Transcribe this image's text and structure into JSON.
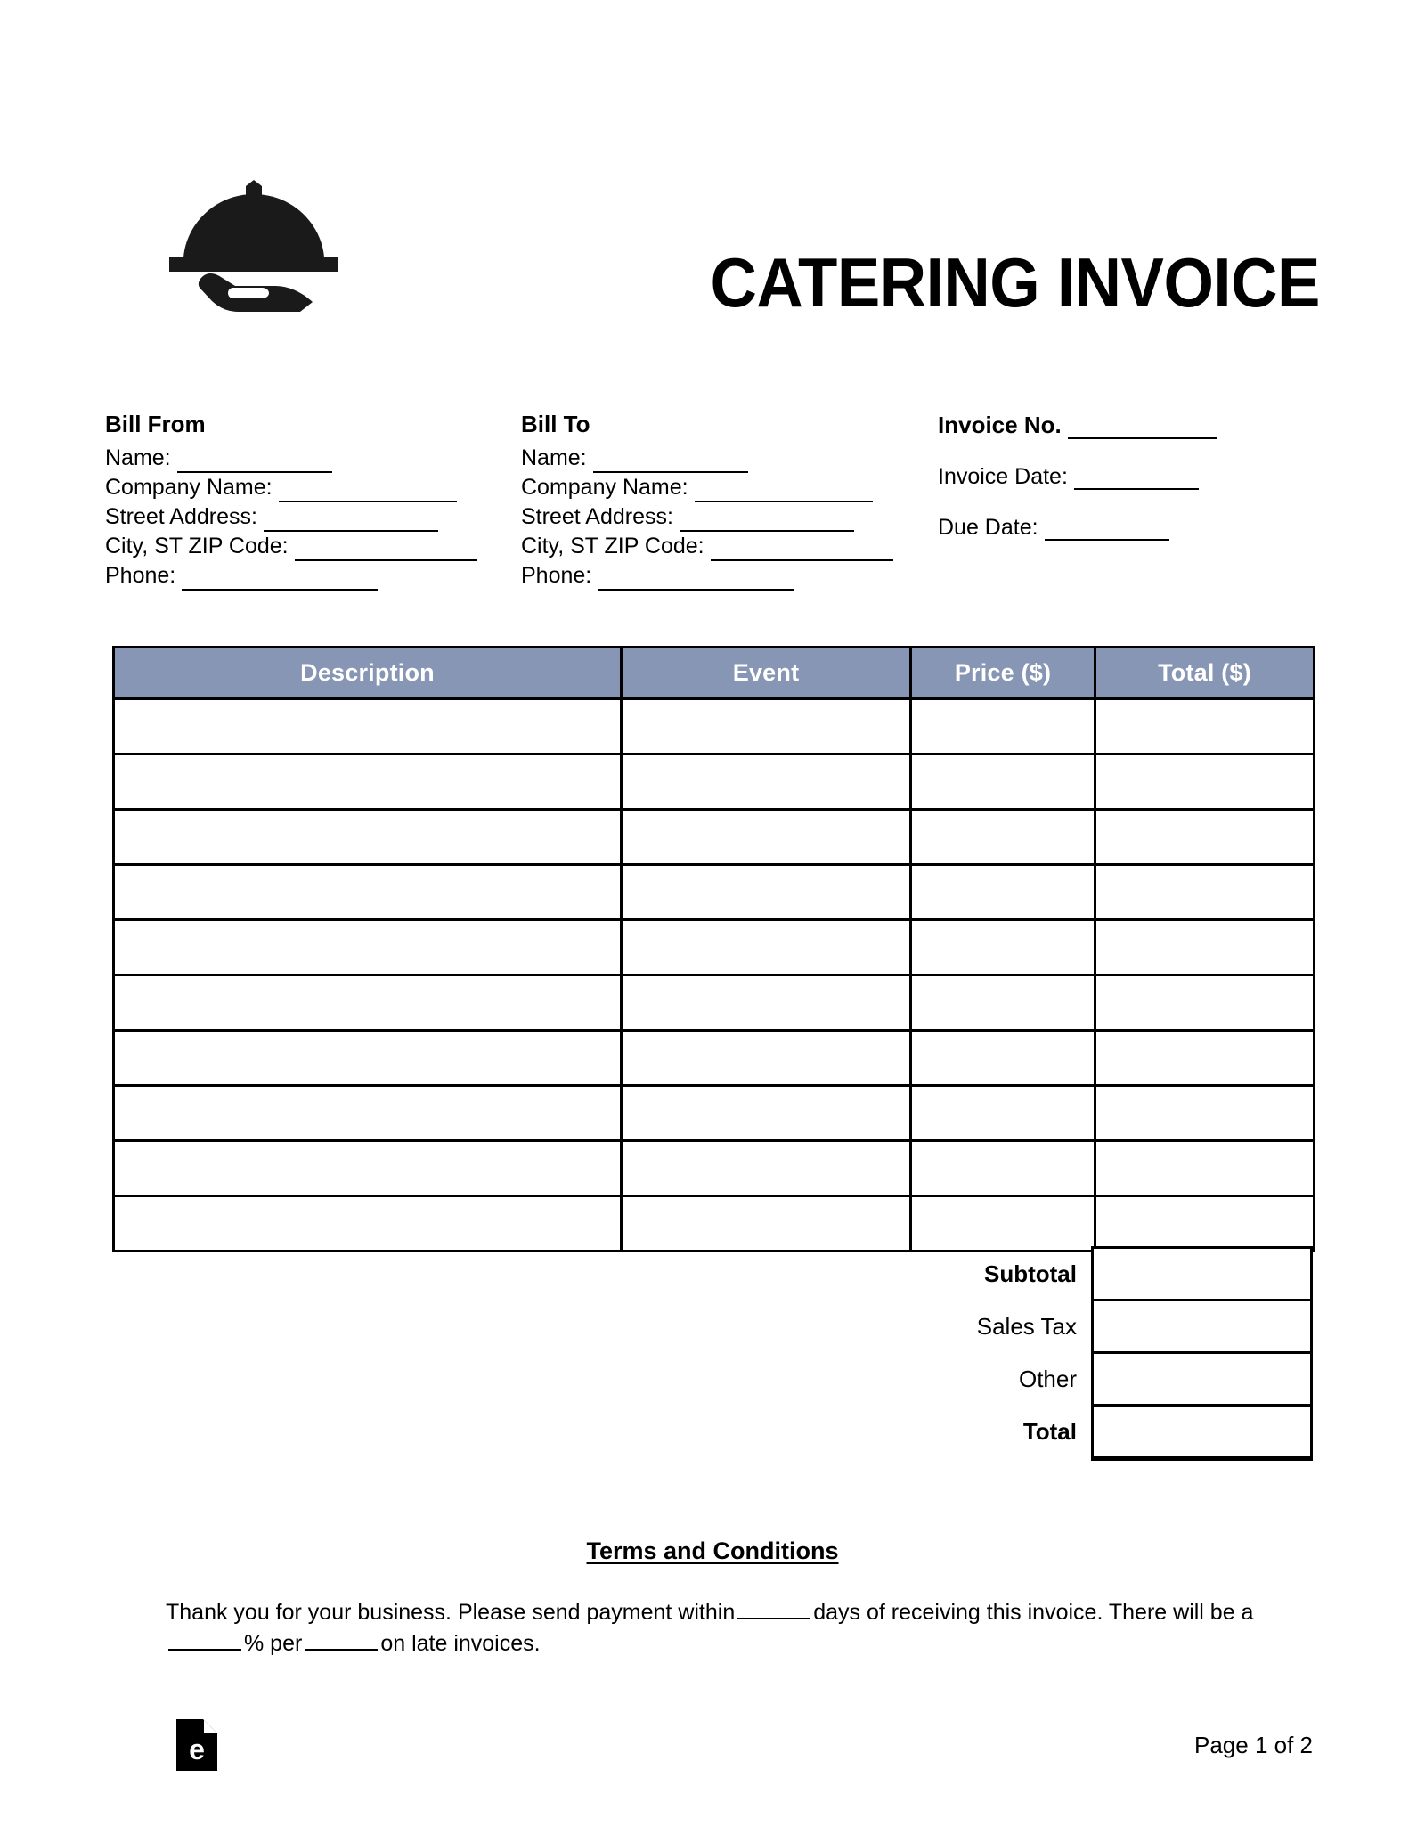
{
  "document": {
    "title": "CATERING INVOICE",
    "logo_icon": "serving-dome-hand-icon"
  },
  "bill_from": {
    "heading": "Bill From",
    "fields": [
      {
        "label": "Name:"
      },
      {
        "label": "Company Name:"
      },
      {
        "label": "Street Address:"
      },
      {
        "label": "City, ST ZIP Code:"
      },
      {
        "label": "Phone:"
      }
    ]
  },
  "bill_to": {
    "heading": "Bill To",
    "fields": [
      {
        "label": "Name:"
      },
      {
        "label": "Company Name:"
      },
      {
        "label": "Street Address:"
      },
      {
        "label": "City, ST ZIP Code:"
      },
      {
        "label": "Phone:"
      }
    ]
  },
  "invoice_meta": {
    "number_label": "Invoice No.",
    "invoice_date_label": "Invoice Date:",
    "due_date_label": "Due Date:"
  },
  "items_table": {
    "header_color": "#8696b4",
    "header_text_color": "#ffffff",
    "columns": [
      "Description",
      "Event",
      "Price ($)",
      "Total ($)"
    ],
    "row_count": 10,
    "rows": [
      [
        "",
        "",
        "",
        ""
      ],
      [
        "",
        "",
        "",
        ""
      ],
      [
        "",
        "",
        "",
        ""
      ],
      [
        "",
        "",
        "",
        ""
      ],
      [
        "",
        "",
        "",
        ""
      ],
      [
        "",
        "",
        "",
        ""
      ],
      [
        "",
        "",
        "",
        ""
      ],
      [
        "",
        "",
        "",
        ""
      ],
      [
        "",
        "",
        "",
        ""
      ],
      [
        "",
        "",
        "",
        ""
      ]
    ]
  },
  "totals": [
    {
      "label": "Subtotal",
      "value": "",
      "bold": true
    },
    {
      "label": "Sales Tax",
      "value": "",
      "bold": false
    },
    {
      "label": "Other",
      "value": "",
      "bold": false
    },
    {
      "label": "Total",
      "value": "",
      "bold": true
    }
  ],
  "terms": {
    "title": "Terms and Conditions",
    "text_part_1": "Thank you for your business. Please send payment within",
    "text_part_2": "days of receiving this invoice. There will be a",
    "text_part_3": "% per",
    "text_part_4": "on late invoices."
  },
  "footer": {
    "logo_icon": "eforms-document-icon",
    "logo_letter": "e",
    "page_label": "Page 1 of 2"
  }
}
